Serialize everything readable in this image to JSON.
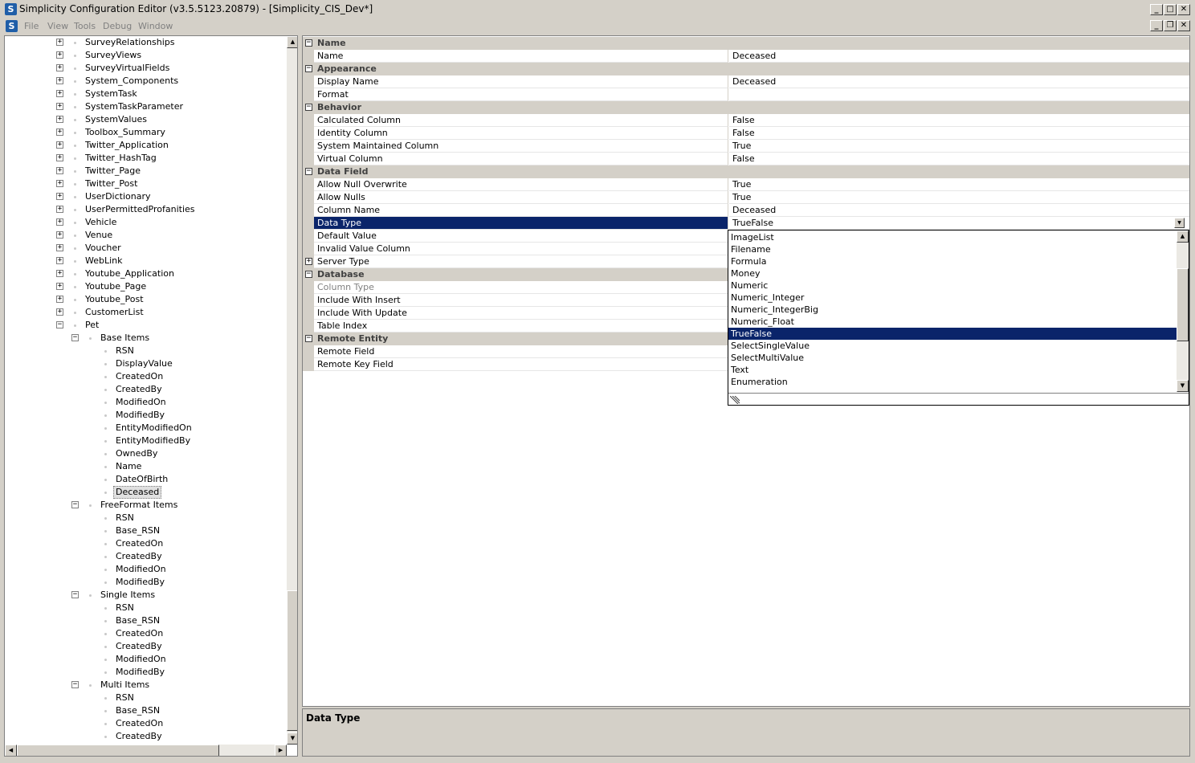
{
  "window": {
    "title": "Simplicity Configuration Editor (v3.5.5123.20879) - [Simplicity_CIS_Dev*]",
    "app_icon_letter": "S"
  },
  "menu": {
    "items": [
      "File",
      "View",
      "Tools",
      "Debug",
      "Window"
    ]
  },
  "tree": {
    "top_items": [
      "SurveyRelationships",
      "SurveyViews",
      "SurveyVirtualFields",
      "System_Components",
      "SystemTask",
      "SystemTaskParameter",
      "SystemValues",
      "Toolbox_Summary",
      "Twitter_Application",
      "Twitter_HashTag",
      "Twitter_Page",
      "Twitter_Post",
      "UserDictionary",
      "UserPermittedProfanities",
      "Vehicle",
      "Venue",
      "Voucher",
      "WebLink",
      "Youtube_Application",
      "Youtube_Page",
      "Youtube_Post",
      "CustomerList",
      "Pet"
    ],
    "groups": [
      {
        "label": "Base Items",
        "items": [
          "RSN",
          "DisplayValue",
          "CreatedOn",
          "CreatedBy",
          "ModifiedOn",
          "ModifiedBy",
          "EntityModifiedOn",
          "EntityModifiedBy",
          "OwnedBy",
          "Name",
          "DateOfBirth",
          "Deceased"
        ]
      },
      {
        "label": "FreeFormat Items",
        "items": [
          "RSN",
          "Base_RSN",
          "CreatedOn",
          "CreatedBy",
          "ModifiedOn",
          "ModifiedBy"
        ]
      },
      {
        "label": "Single Items",
        "items": [
          "RSN",
          "Base_RSN",
          "CreatedOn",
          "CreatedBy",
          "ModifiedOn",
          "ModifiedBy"
        ]
      },
      {
        "label": "Multi Items",
        "items": [
          "RSN",
          "Base_RSN",
          "CreatedOn",
          "CreatedBy"
        ]
      }
    ],
    "selected_item": "Deceased"
  },
  "properties": {
    "rows": [
      {
        "kind": "category",
        "label": "Name"
      },
      {
        "kind": "prop",
        "name": "Name",
        "value": "Deceased"
      },
      {
        "kind": "category",
        "label": "Appearance"
      },
      {
        "kind": "prop",
        "name": "Display Name",
        "value": "Deceased"
      },
      {
        "kind": "prop",
        "name": "Format",
        "value": ""
      },
      {
        "kind": "category",
        "label": "Behavior"
      },
      {
        "kind": "prop",
        "name": "Calculated Column",
        "value": "False"
      },
      {
        "kind": "prop",
        "name": "Identity Column",
        "value": "False"
      },
      {
        "kind": "prop",
        "name": "System Maintained Column",
        "value": "True"
      },
      {
        "kind": "prop",
        "name": "Virtual Column",
        "value": "False"
      },
      {
        "kind": "category",
        "label": "Data Field"
      },
      {
        "kind": "prop",
        "name": "Allow Null Overwrite",
        "value": "True"
      },
      {
        "kind": "prop",
        "name": "Allow Nulls",
        "value": "True"
      },
      {
        "kind": "prop",
        "name": "Column Name",
        "value": "Deceased"
      },
      {
        "kind": "prop",
        "name": "Data Type",
        "value": "TrueFalse",
        "selected": true
      },
      {
        "kind": "prop",
        "name": "Default Value",
        "value": ""
      },
      {
        "kind": "prop",
        "name": "Invalid Value Column",
        "value": ""
      },
      {
        "kind": "prop",
        "name": "Server Type",
        "value": "",
        "expandable": true
      },
      {
        "kind": "category",
        "label": "Database"
      },
      {
        "kind": "prop",
        "name": "Column Type",
        "value": "",
        "disabled": true
      },
      {
        "kind": "prop",
        "name": "Include With Insert",
        "value": ""
      },
      {
        "kind": "prop",
        "name": "Include With Update",
        "value": ""
      },
      {
        "kind": "prop",
        "name": "Table Index",
        "value": ""
      },
      {
        "kind": "category",
        "label": "Remote Entity"
      },
      {
        "kind": "prop",
        "name": "Remote Field",
        "value": ""
      },
      {
        "kind": "prop",
        "name": "Remote Key Field",
        "value": ""
      }
    ]
  },
  "dropdown": {
    "options": [
      "ImageList",
      "Filename",
      "Formula",
      "Money",
      "Numeric",
      "Numeric_Integer",
      "Numeric_IntegerBig",
      "Numeric_Float",
      "TrueFalse",
      "SelectSingleValue",
      "SelectMultiValue",
      "Text",
      "Enumeration"
    ],
    "selected": "TrueFalse"
  },
  "description": {
    "title": "Data Type"
  },
  "colors": {
    "selection": "#0a246a",
    "chrome": "#d4d0c8"
  }
}
